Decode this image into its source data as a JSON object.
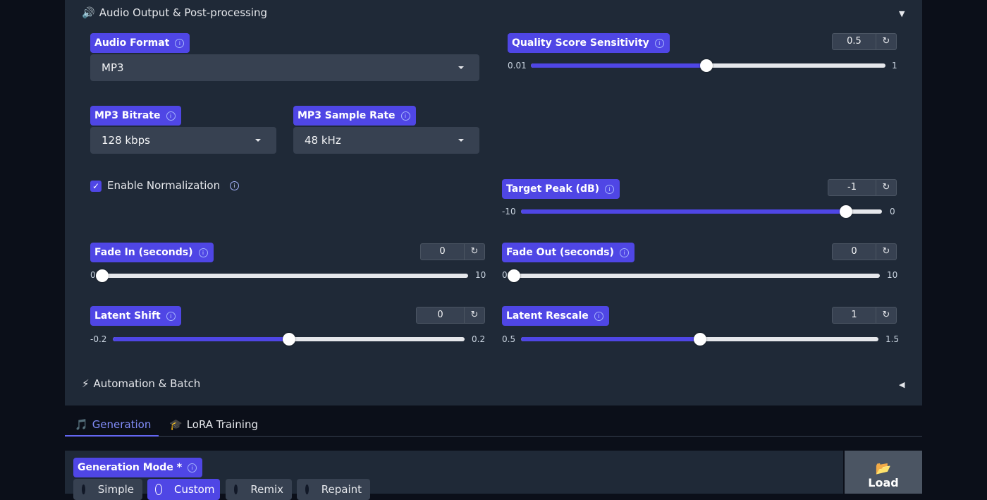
{
  "accordion_audio": {
    "icon": "🔊",
    "title": "Audio Output & Post-processing",
    "caret": "▼"
  },
  "accordion_automation": {
    "icon": "⚡",
    "title": "Automation & Batch",
    "caret": "◀"
  },
  "audio_format": {
    "label": "Audio Format",
    "value": "MP3"
  },
  "mp3_bitrate": {
    "label": "MP3 Bitrate",
    "value": "128 kbps"
  },
  "mp3_sample_rate": {
    "label": "MP3 Sample Rate",
    "value": "48 kHz"
  },
  "normalization": {
    "label": "Enable Normalization",
    "checked": true,
    "check": "✓"
  },
  "sliders": {
    "quality": {
      "label": "Quality Score Sensitivity",
      "value": "0.5",
      "min": "0.01",
      "max": "1",
      "fraction": 0.495
    },
    "target_peak": {
      "label": "Target Peak (dB)",
      "value": "-1",
      "min": "-10",
      "max": "0",
      "fraction": 0.9
    },
    "fade_in": {
      "label": "Fade In (seconds)",
      "value": "0",
      "min": "0",
      "max": "10",
      "fraction": 0
    },
    "fade_out": {
      "label": "Fade Out (seconds)",
      "value": "0",
      "min": "0",
      "max": "10",
      "fraction": 0
    },
    "latent_shift": {
      "label": "Latent Shift",
      "value": "0",
      "min": "-0.2",
      "max": "0.2",
      "fraction": 0.5
    },
    "latent_rescale": {
      "label": "Latent Rescale",
      "value": "1",
      "min": "0.5",
      "max": "1.5",
      "fraction": 0.5
    }
  },
  "reset_icon": "↻",
  "tabs": [
    {
      "icon": "🎵",
      "label": "Generation",
      "active": true
    },
    {
      "icon": "🎓",
      "label": "LoRA Training",
      "active": false
    }
  ],
  "generation_mode": {
    "label": "Generation Mode *",
    "options": [
      "Simple",
      "Custom",
      "Remix",
      "Repaint"
    ],
    "selected": "Custom"
  },
  "load_button": {
    "icon": "📂",
    "label": "Load"
  },
  "colors": {
    "accent": "#4f46e5",
    "panel": "#1f2937",
    "background": "#0b0f19"
  }
}
